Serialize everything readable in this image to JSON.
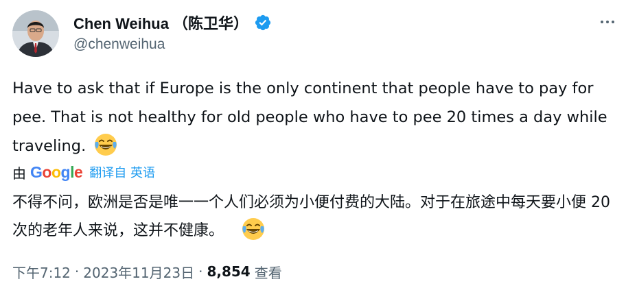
{
  "author": {
    "display_name": "Chen Weihua （陈卫华）",
    "handle": "@chenweihua",
    "verified_icon": "verified-badge-icon",
    "avatar_icon": "avatar-photo"
  },
  "menu": {
    "more_icon": "more-options-icon"
  },
  "tweet": {
    "text": "Have to ask that if Europe is the only continent that people have to pay for pee. That is not healthy for old people who have to pee 20 times a day while traveling.",
    "emoji": "face-with-tears-of-joy"
  },
  "translation": {
    "by": "由",
    "google": "Google",
    "translated_from": "翻译自 英语",
    "text": "不得不问，欧洲是否是唯一一个人们必须为小便付费的大陆。对于在旅途中每天要小便 20 次的老年人来说，这并不健康。",
    "emoji": "face-with-tears-of-joy"
  },
  "meta": {
    "time": "下午7:12",
    "separator": "·",
    "date": "2023年11月23日",
    "views_count": "8,854",
    "views_label": "查看"
  },
  "colors": {
    "text": "#0f1419",
    "secondary": "#536471",
    "link": "#1d9bf0",
    "verified": "#1d9bf0"
  }
}
